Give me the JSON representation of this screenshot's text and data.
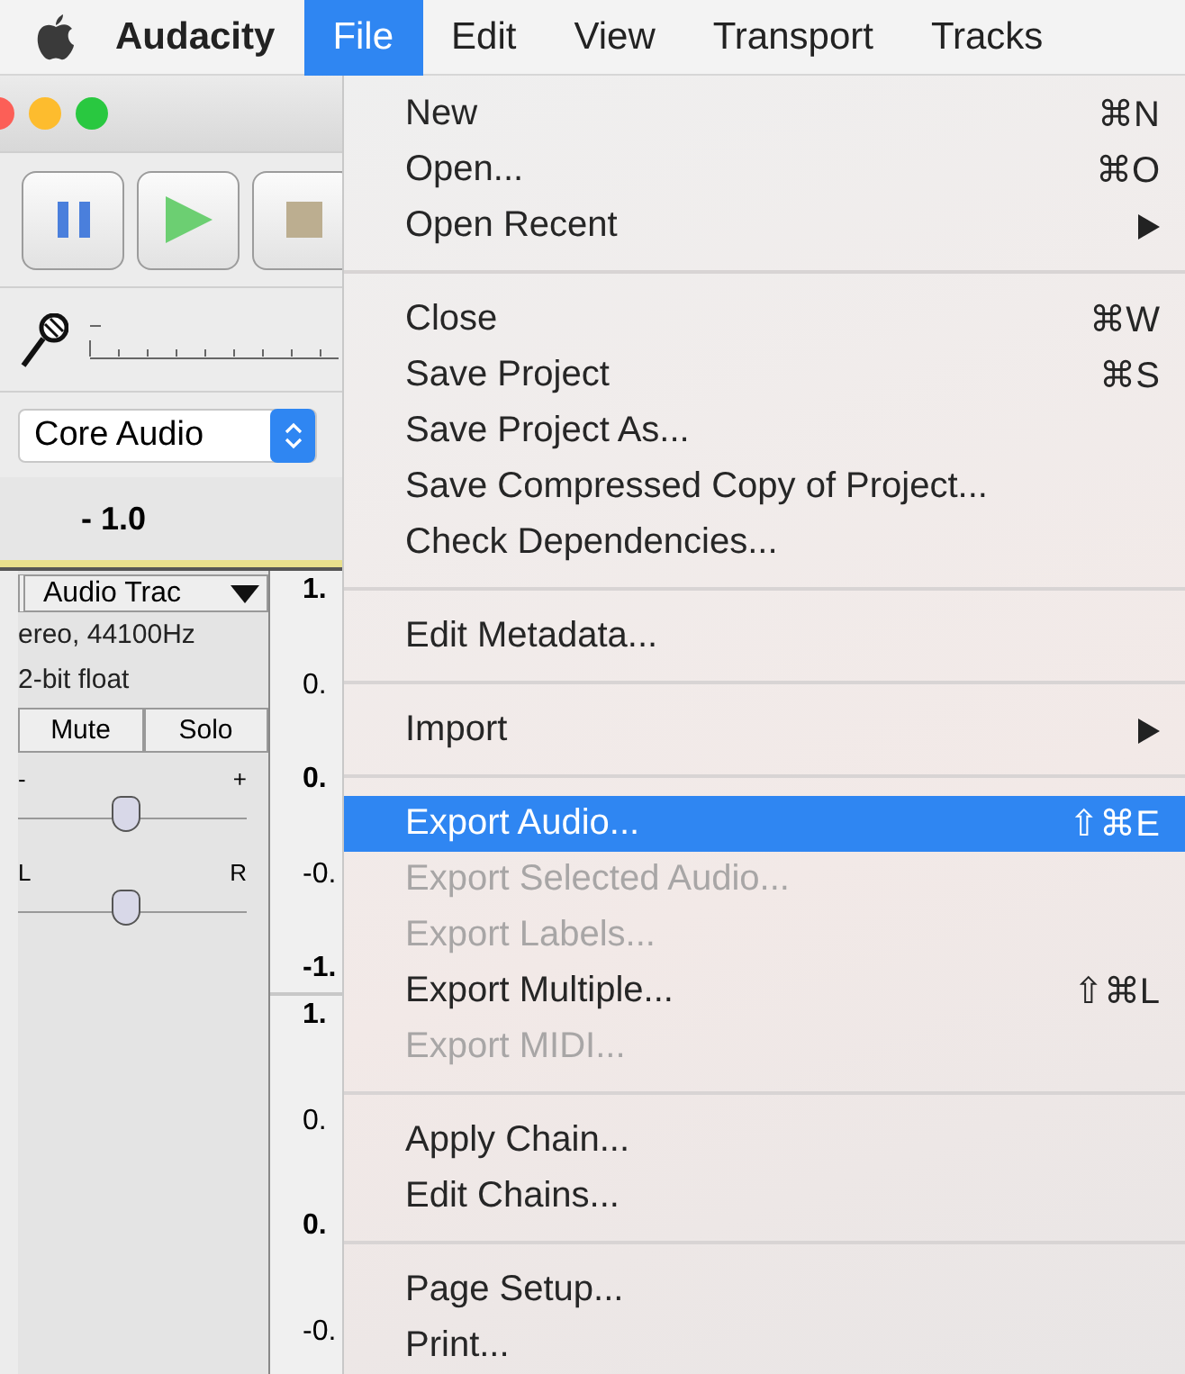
{
  "menu_bar": {
    "app_name": "Audacity",
    "menus": [
      {
        "label": "File",
        "selected": true
      },
      {
        "label": "Edit",
        "selected": false
      },
      {
        "label": "View",
        "selected": false
      },
      {
        "label": "Transport",
        "selected": false
      },
      {
        "label": "Tracks",
        "selected": false
      }
    ]
  },
  "project_window": {
    "device": "Core Audio",
    "ruler_label": "- 1.0",
    "track": {
      "name": "Audio Trac",
      "info": [
        "ereo, 44100Hz",
        "2-bit float"
      ],
      "buttons": [
        "Mute",
        "Solo"
      ],
      "gain": {
        "min_label": "-",
        "max_label": "+",
        "level": 0.47
      },
      "pan": {
        "min_label": "L",
        "max_label": "R",
        "level": 0.47
      }
    },
    "scale": [
      [
        "1.",
        "0.",
        "0.",
        "-0.",
        "-1."
      ],
      [
        "1.",
        "0.",
        "0.",
        "-0."
      ]
    ]
  },
  "file_menu": [
    {
      "items": [
        {
          "label": "New",
          "shortcut": "⌘N",
          "submenu": false,
          "disabled": false,
          "selected": false
        },
        {
          "label": "Open...",
          "shortcut": "⌘O",
          "submenu": false,
          "disabled": false,
          "selected": false
        },
        {
          "label": "Open Recent",
          "submenu": true,
          "disabled": false,
          "selected": false
        }
      ]
    },
    {
      "items": [
        {
          "label": "Close",
          "shortcut": "⌘W",
          "submenu": false,
          "disabled": false,
          "selected": false
        },
        {
          "label": "Save Project",
          "shortcut": "⌘S",
          "submenu": false,
          "disabled": false,
          "selected": false
        },
        {
          "label": "Save Project As...",
          "submenu": false,
          "disabled": false,
          "selected": false
        },
        {
          "label": "Save Compressed Copy of Project...",
          "submenu": false,
          "disabled": false,
          "selected": false
        },
        {
          "label": "Check Dependencies...",
          "submenu": false,
          "disabled": false,
          "selected": false
        }
      ]
    },
    {
      "items": [
        {
          "label": "Edit Metadata...",
          "submenu": false,
          "disabled": false,
          "selected": false
        }
      ]
    },
    {
      "items": [
        {
          "label": "Import",
          "submenu": true,
          "disabled": false,
          "selected": false
        }
      ]
    },
    {
      "items": [
        {
          "label": "Export Audio...",
          "shortcut": "⇧⌘E",
          "submenu": false,
          "disabled": false,
          "selected": true
        },
        {
          "label": "Export Selected Audio...",
          "submenu": false,
          "disabled": true,
          "selected": false
        },
        {
          "label": "Export Labels...",
          "submenu": false,
          "disabled": true,
          "selected": false
        },
        {
          "label": "Export Multiple...",
          "shortcut": "⇧⌘L",
          "submenu": false,
          "disabled": false,
          "selected": false
        },
        {
          "label": "Export MIDI...",
          "submenu": false,
          "disabled": true,
          "selected": false
        }
      ]
    },
    {
      "items": [
        {
          "label": "Apply Chain...",
          "submenu": false,
          "disabled": false,
          "selected": false
        },
        {
          "label": "Edit Chains...",
          "submenu": false,
          "disabled": false,
          "selected": false
        }
      ]
    },
    {
      "items": [
        {
          "label": "Page Setup...",
          "submenu": false,
          "disabled": false,
          "selected": false
        },
        {
          "label": "Print...",
          "submenu": false,
          "disabled": false,
          "selected": false
        }
      ]
    }
  ]
}
